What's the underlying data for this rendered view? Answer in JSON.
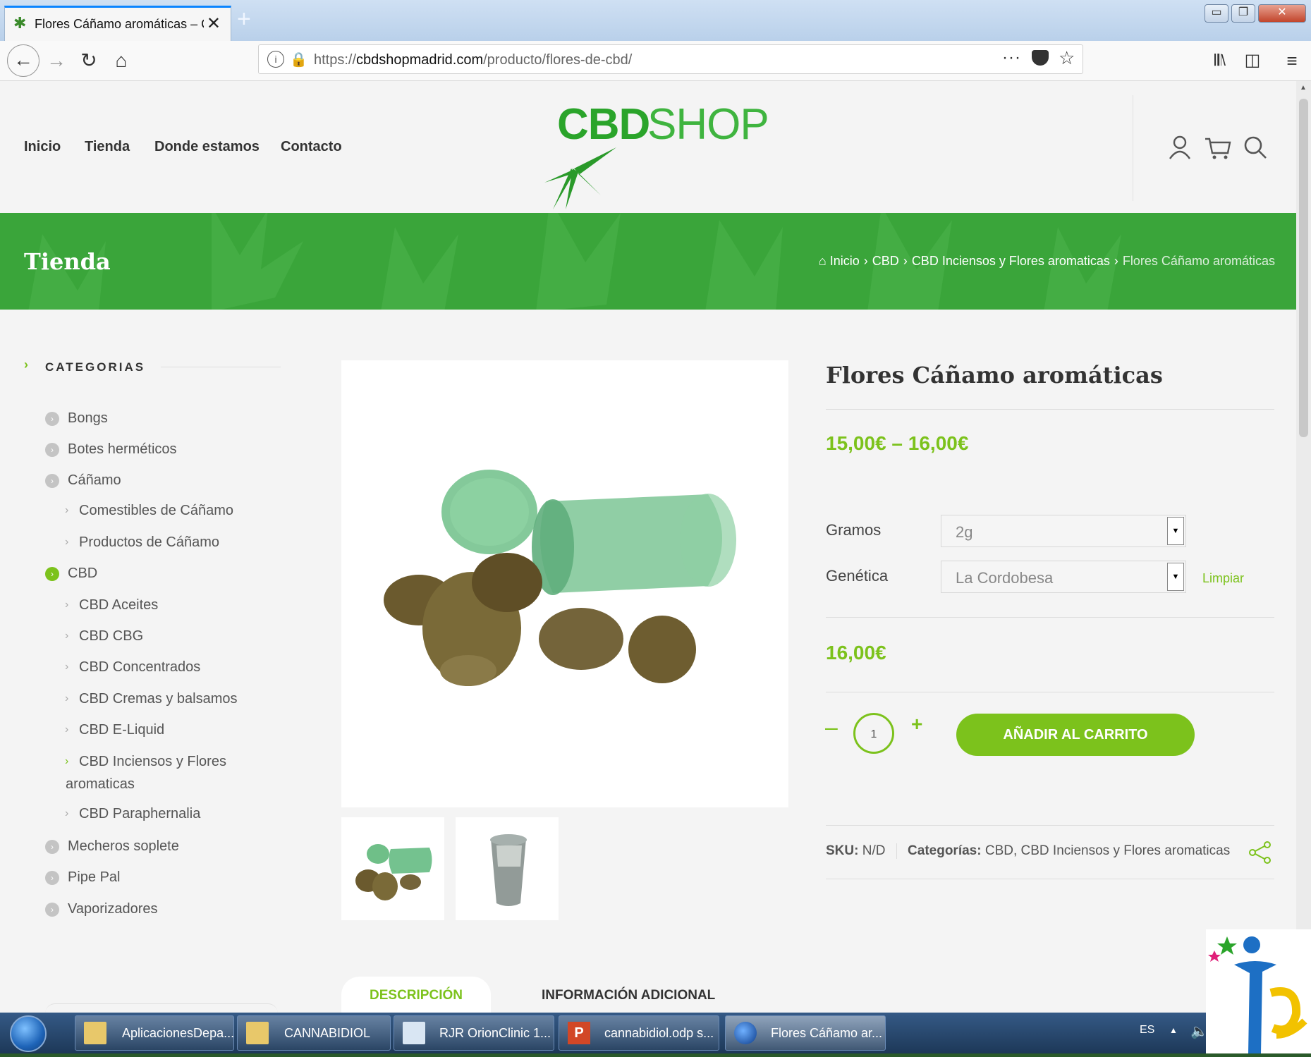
{
  "browser": {
    "tab_title": "Flores Cáñamo aromáticas – CBD",
    "url_prefix": "https://",
    "url_domain": "cbdshopmadrid.com",
    "url_path": "/producto/flores-de-cbd/"
  },
  "site": {
    "menu": [
      "Inicio",
      "Tienda",
      "Donde estamos",
      "Contacto"
    ],
    "logo_part1": "CBD",
    "logo_part2": "SHOP",
    "banner_title": "Tienda",
    "breadcrumb": [
      "Inicio",
      "CBD",
      "CBD Inciensos y Flores aromaticas",
      "Flores Cáñamo aromáticas"
    ]
  },
  "sidebar": {
    "heading": "CATEGORIAS",
    "items": [
      {
        "label": "Bongs",
        "level": 1
      },
      {
        "label": "Botes herméticos",
        "level": 1
      },
      {
        "label": "Cáñamo",
        "level": 1
      },
      {
        "label": "Comestibles de Cáñamo",
        "level": 2
      },
      {
        "label": "Productos de Cáñamo",
        "level": 2
      },
      {
        "label": "CBD",
        "level": 1,
        "active": true
      },
      {
        "label": "CBD Aceites",
        "level": 2
      },
      {
        "label": "CBD CBG",
        "level": 2
      },
      {
        "label": "CBD Concentrados",
        "level": 2
      },
      {
        "label": "CBD Cremas y balsamos",
        "level": 2
      },
      {
        "label": "CBD E-Liquid",
        "level": 2
      },
      {
        "label": "CBD Inciensos y Flores",
        "label_cont": "aromaticas",
        "level": 2,
        "active": true
      },
      {
        "label": "CBD Paraphernalia",
        "level": 2
      },
      {
        "label": "Mecheros soplete",
        "level": 1
      },
      {
        "label": "Pipe Pal",
        "level": 1
      },
      {
        "label": "Vaporizadores",
        "level": 1
      }
    ]
  },
  "product": {
    "title": "Flores Cáñamo aromáticas",
    "price_range": "15,00€ – 16,00€",
    "gramos_label": "Gramos",
    "gramos_value": "2g",
    "genetica_label": "Genética",
    "genetica_value": "La Cordobesa",
    "clear_label": "Limpiar",
    "selected_price": "16,00€",
    "quantity": "1",
    "add_to_cart": "AÑADIR AL CARRITO",
    "sku_label": "SKU:",
    "sku_value": "N/D",
    "categories_label": "Categorías:",
    "categories_value": "CBD, CBD Inciensos y Flores aromaticas"
  },
  "tabs": [
    "DESCRIPCIÓN",
    "INFORMACIÓN ADICIONAL"
  ],
  "taskbar": {
    "items": [
      "AplicacionesDepa...",
      "CANNABIDIOL",
      "RJR OrionClinic 1...",
      "cannabidiol.odp s...",
      "Flores Cáñamo ar..."
    ],
    "lang": "ES"
  },
  "colors": {
    "accent": "#7cc21c",
    "banner": "#3aa53a",
    "logo": "#2aa42a"
  }
}
